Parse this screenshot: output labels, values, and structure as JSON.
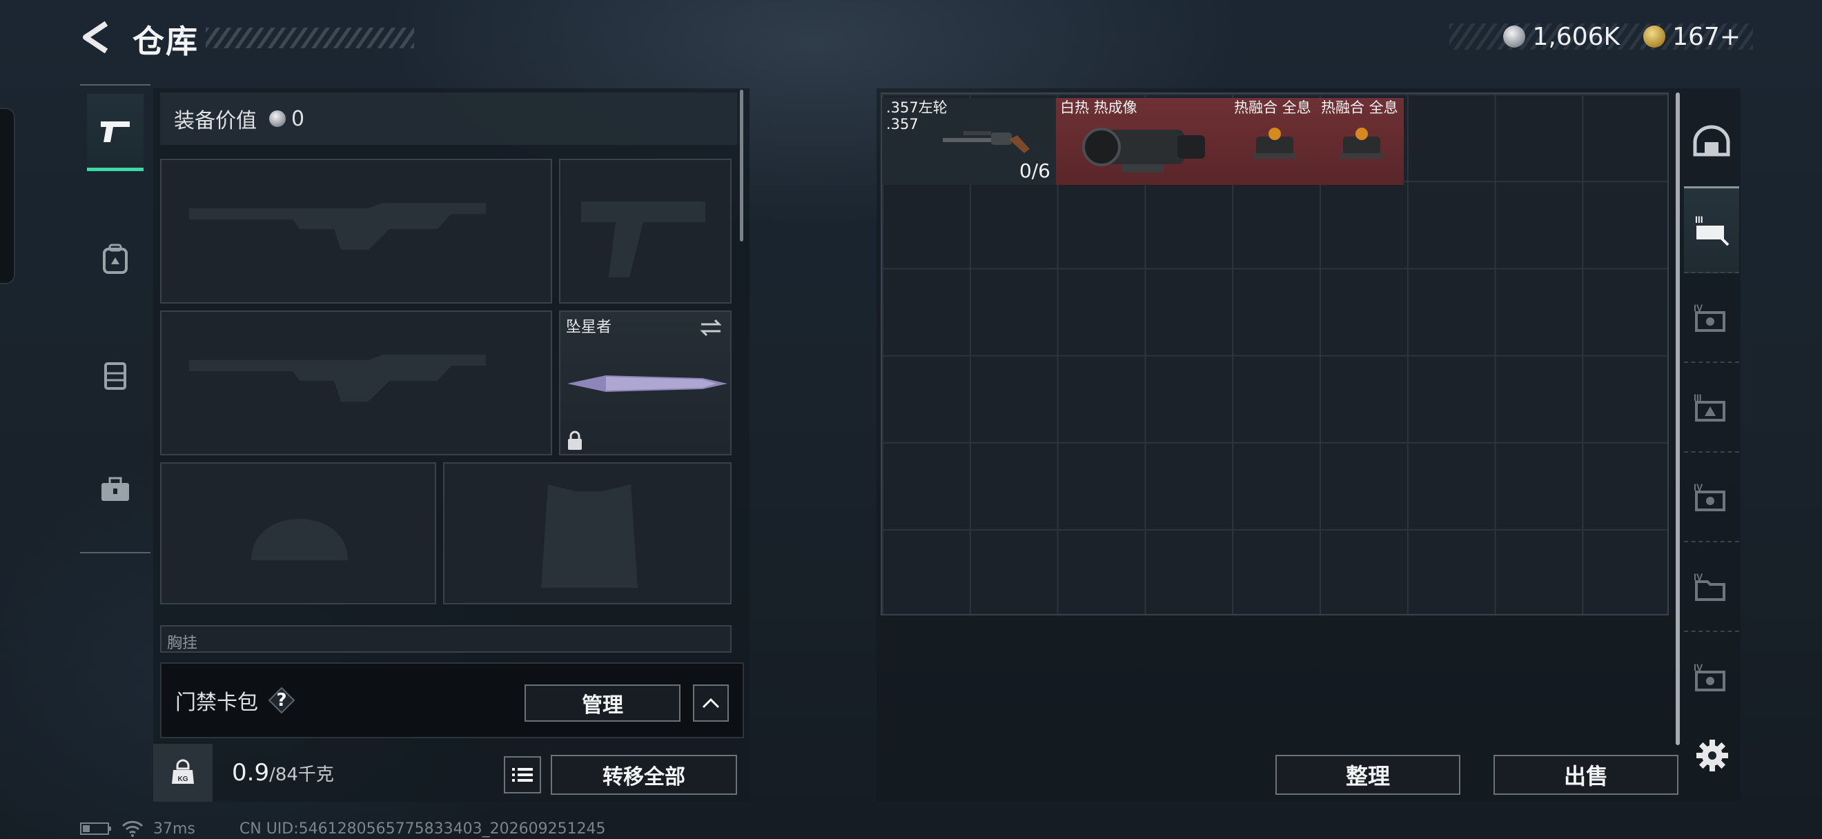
{
  "header": {
    "title": "仓库",
    "currency_silver": "1,606K",
    "currency_gold": "167+"
  },
  "loadout": {
    "value_label": "装备价值",
    "value_amount": "0",
    "melee_name": "坠星者",
    "chest_label": "胸挂",
    "card_pack_label": "门禁卡包",
    "card_pack_help": "?",
    "manage_label": "管理",
    "weight_current": "0.9",
    "weight_max": "/84千克",
    "transfer_all_label": "转移全部"
  },
  "storage": {
    "items": [
      {
        "name": ".357左轮\n.357",
        "count": "0/6"
      },
      {
        "name": "白热 热成像"
      },
      {
        "name": "热融合 全息"
      },
      {
        "name": "热融合 全息"
      }
    ],
    "sort_label": "整理",
    "sell_label": "出售"
  },
  "status": {
    "ping": "37ms",
    "uid": "CN UID:5461280565775833403_202609251245"
  },
  "colors": {
    "accent": "#3fd8a8",
    "item_highlight": "#6e3135"
  }
}
